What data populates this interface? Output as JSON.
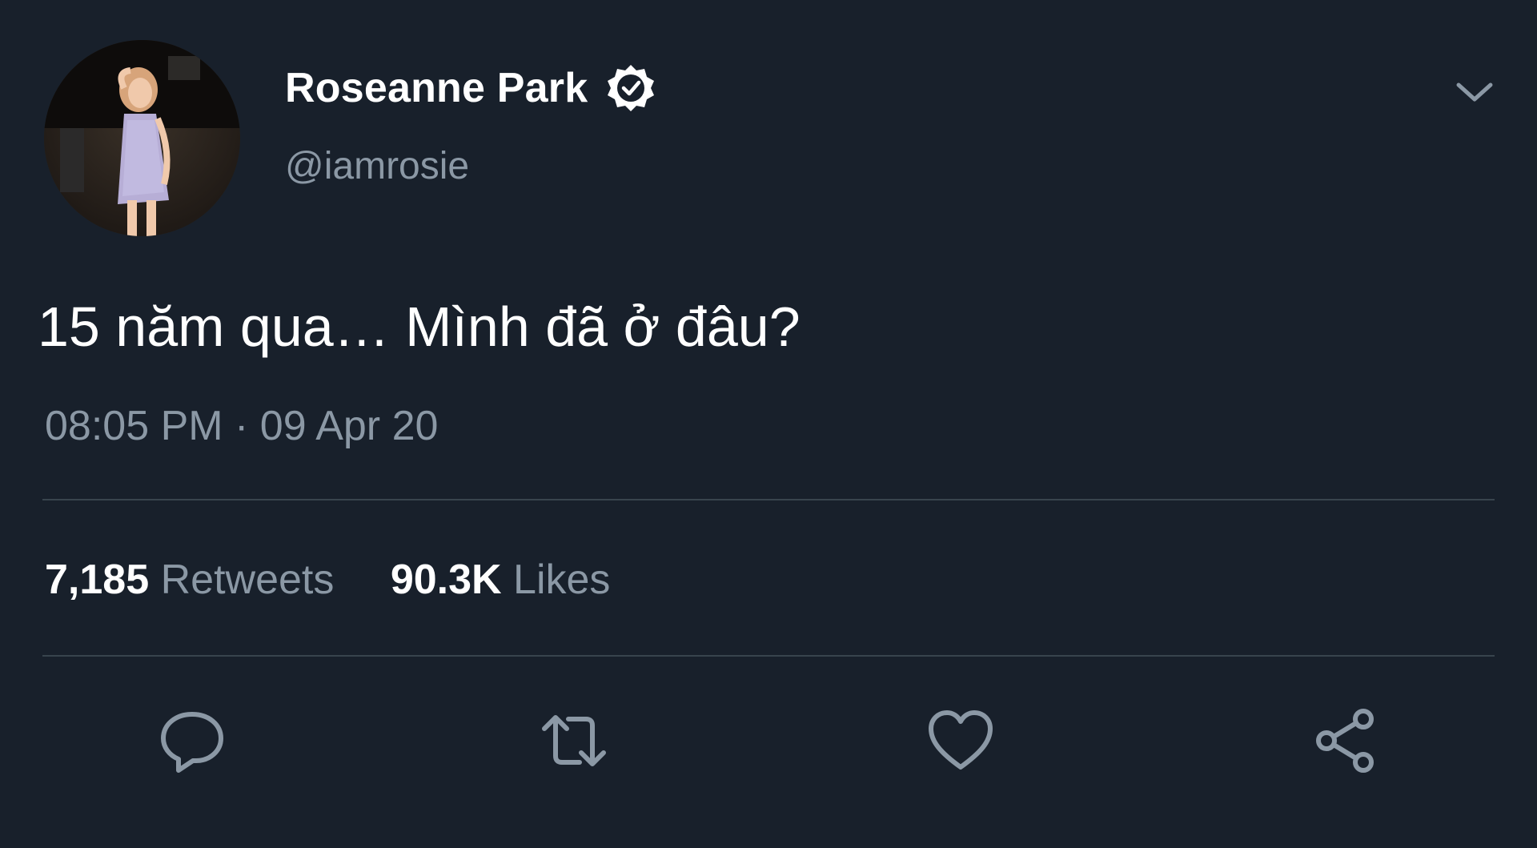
{
  "user": {
    "display_name": "Roseanne Park",
    "handle": "@iamrosie",
    "verified": true,
    "avatar_icon": "profile-photo"
  },
  "tweet": {
    "text": "15 năm qua… Mình đã ở đâu?",
    "timestamp": "08:05 PM · 09 Apr 20"
  },
  "stats": {
    "retweets_count": "7,185",
    "retweets_label": "Retweets",
    "likes_count": "90.3K",
    "likes_label": "Likes"
  },
  "actions": [
    {
      "icon": "reply-icon"
    },
    {
      "icon": "retweet-icon"
    },
    {
      "icon": "like-icon"
    },
    {
      "icon": "share-icon"
    }
  ],
  "menu": {
    "icon": "chevron-down-icon"
  },
  "colors": {
    "background": "#18202b",
    "text_primary": "#ffffff",
    "text_secondary": "#8b98a5",
    "divider": "#38444d"
  }
}
